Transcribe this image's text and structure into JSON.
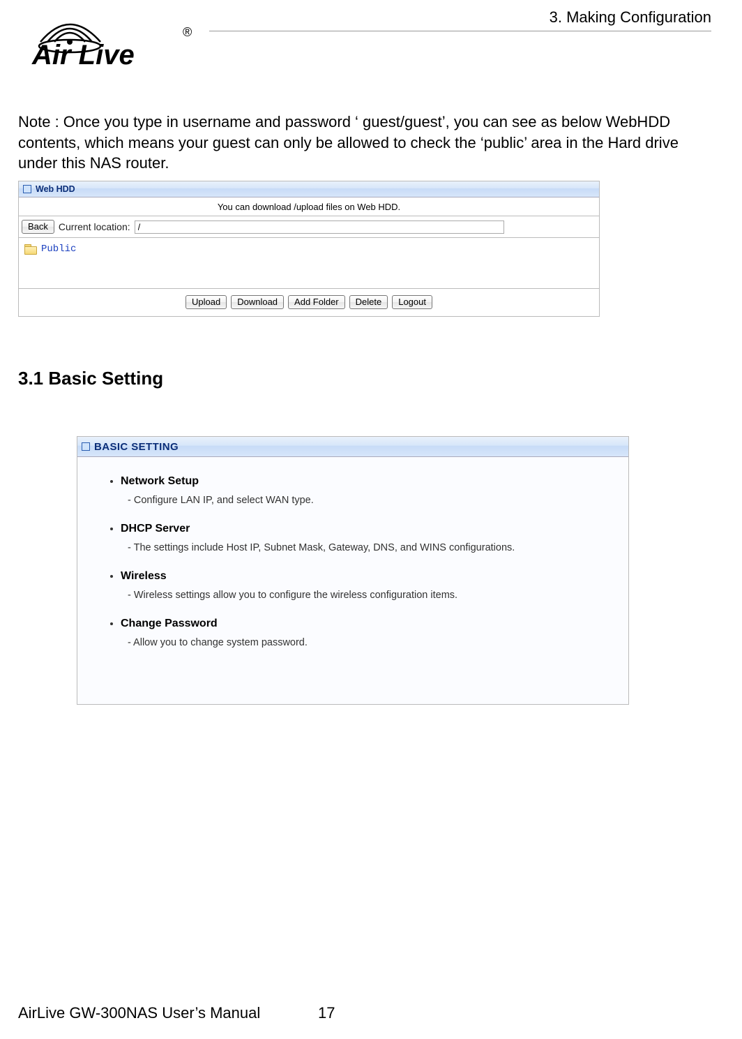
{
  "header": {
    "chapter": "3.  Making  Configuration",
    "logo_text": "Air Live",
    "reg_mark": "®"
  },
  "note": "Note : Once you type in username and password ‘ guest/guest’, you can see as below WebHDD contents, which means your guest can only be allowed to check the ‘public’ area in the Hard drive under this NAS router.",
  "webhdd": {
    "title": "Web HDD",
    "desc": "You can download /upload files on Web HDD.",
    "back_label": "Back",
    "location_label": "Current location:",
    "location_value": "/",
    "folder_name": "Public",
    "buttons": {
      "upload": "Upload",
      "download": "Download",
      "add_folder": "Add Folder",
      "delete": "Delete",
      "logout": "Logout"
    }
  },
  "section_heading": "3.1 Basic Setting",
  "basic": {
    "title": "BASIC SETTING",
    "items": [
      {
        "title": "Network Setup",
        "desc": "- Configure LAN IP, and select WAN type."
      },
      {
        "title": "DHCP Server",
        "desc": "- The settings include Host IP, Subnet Mask, Gateway, DNS, and WINS configurations."
      },
      {
        "title": "Wireless",
        "desc": "- Wireless settings allow you to configure the wireless configuration items."
      },
      {
        "title": "Change Password",
        "desc": "- Allow you to change system password."
      }
    ]
  },
  "footer": {
    "manual": "AirLive GW-300NAS User’s Manual",
    "page": "17"
  }
}
